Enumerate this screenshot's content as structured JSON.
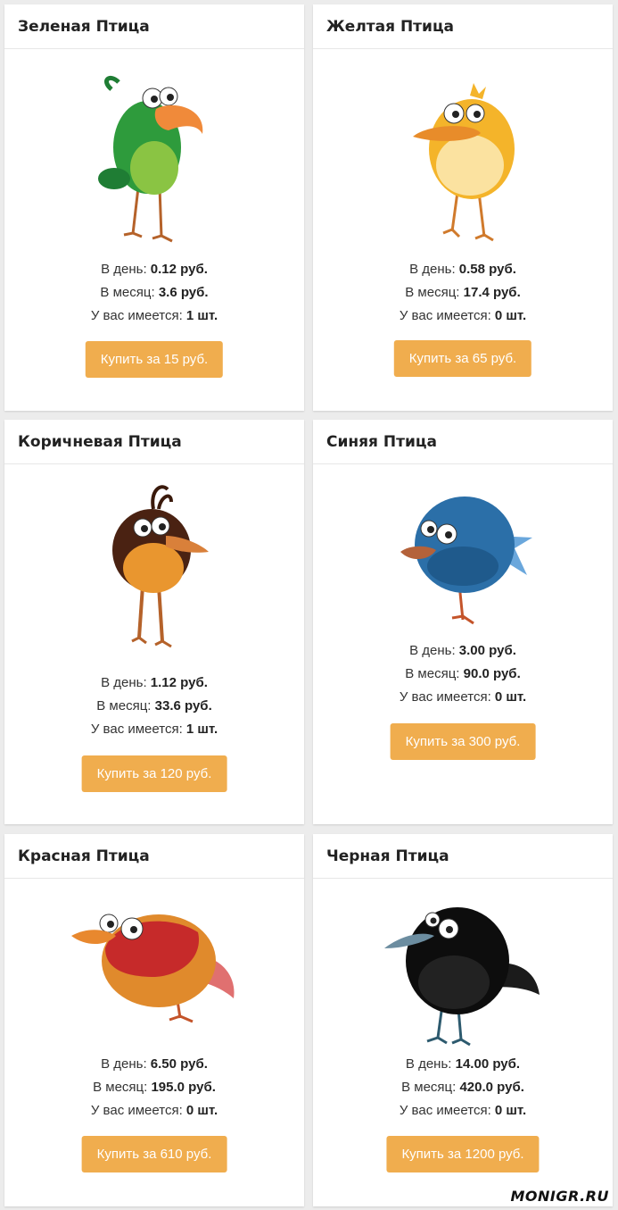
{
  "labels": {
    "per_day": "В день:",
    "per_month": "В месяц:",
    "owned": "У вас имеется:"
  },
  "birds": [
    {
      "title": "Зеленая Птица",
      "per_day": "0.12 руб.",
      "per_month": "3.6 руб.",
      "owned": "1 шт.",
      "buy_label": "Купить за 15 руб."
    },
    {
      "title": "Желтая Птица",
      "per_day": "0.58 руб.",
      "per_month": "17.4 руб.",
      "owned": "0 шт.",
      "buy_label": "Купить за 65 руб."
    },
    {
      "title": "Коричневая Птица",
      "per_day": "1.12 руб.",
      "per_month": "33.6 руб.",
      "owned": "1 шт.",
      "buy_label": "Купить за 120 руб."
    },
    {
      "title": "Синяя Птица",
      "per_day": "3.00 руб.",
      "per_month": "90.0 руб.",
      "owned": "0 шт.",
      "buy_label": "Купить за 300 руб."
    },
    {
      "title": "Красная Птица",
      "per_day": "6.50 руб.",
      "per_month": "195.0 руб.",
      "owned": "0 шт.",
      "buy_label": "Купить за 610 руб."
    },
    {
      "title": "Черная Птица",
      "per_day": "14.00 руб.",
      "per_month": "420.0 руб.",
      "owned": "0 шт.",
      "buy_label": "Купить за 1200 руб."
    }
  ],
  "watermark": "MONIGR.RU",
  "colors": {
    "button": "#f0ad4e",
    "background": "#ececec"
  }
}
